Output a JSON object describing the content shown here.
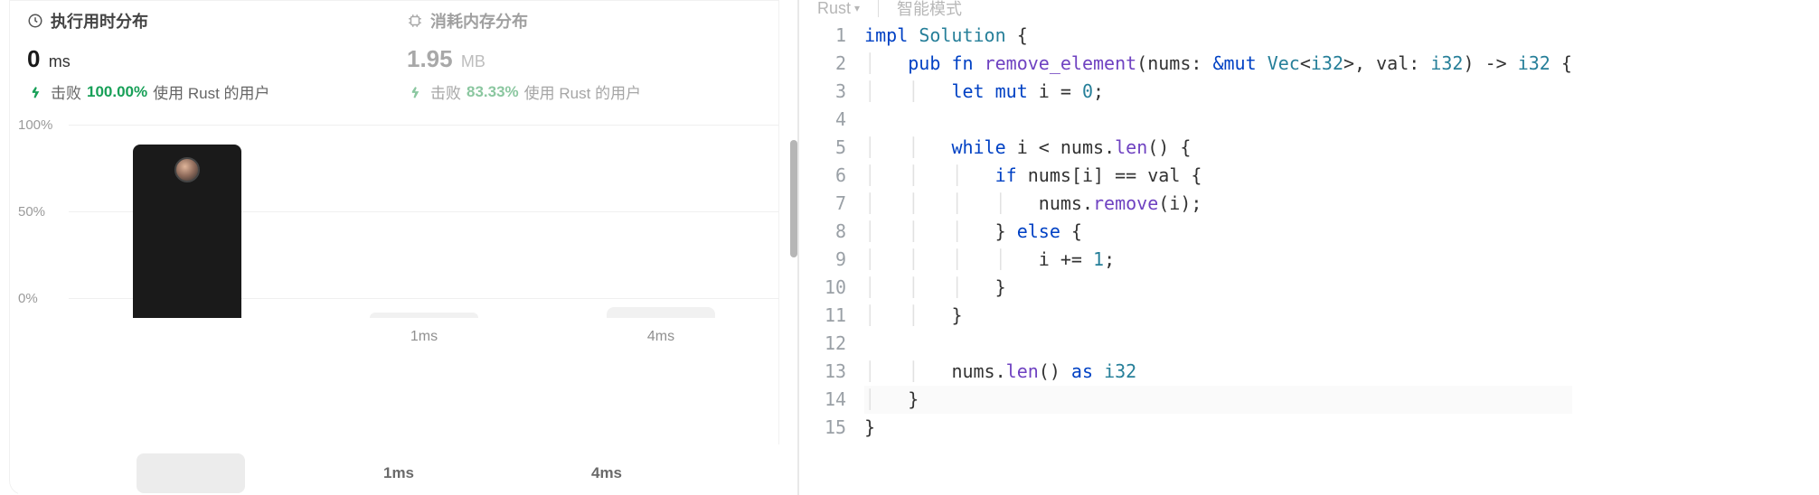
{
  "stats": {
    "runtime": {
      "title": "执行用时分布",
      "value": "0",
      "unit": "ms",
      "beat_word": "击败",
      "beat_pct": "100.00%",
      "beat_suffix": "使用 Rust 的用户"
    },
    "memory": {
      "title": "消耗内存分布",
      "value": "1.95",
      "unit": "MB",
      "beat_word": "击败",
      "beat_pct": "83.33%",
      "beat_suffix": "使用 Rust 的用户"
    }
  },
  "chart_data": {
    "type": "bar",
    "categories": [
      "",
      "1ms",
      "4ms"
    ],
    "values": [
      100,
      3,
      6
    ],
    "ylabel": "",
    "ylim": [
      0,
      100
    ],
    "y_ticks": [
      "100%",
      "50%",
      "0%"
    ],
    "active_index": 0
  },
  "tabs": {
    "items": [
      "",
      "1ms",
      "4ms"
    ],
    "active_index": 0
  },
  "editor": {
    "language": "Rust",
    "mode": "智能模式",
    "lines": [
      "impl Solution {",
      "    pub fn remove_element(nums: &mut Vec<i32>, val: i32) -> i32 {",
      "        let mut i = 0;",
      "",
      "        while i < nums.len() {",
      "            if nums[i] == val {",
      "                nums.remove(i);",
      "            } else {",
      "                i += 1;",
      "            }",
      "        }",
      "",
      "        nums.len() as i32",
      "    }",
      "}"
    ],
    "highlight_line": 14
  }
}
